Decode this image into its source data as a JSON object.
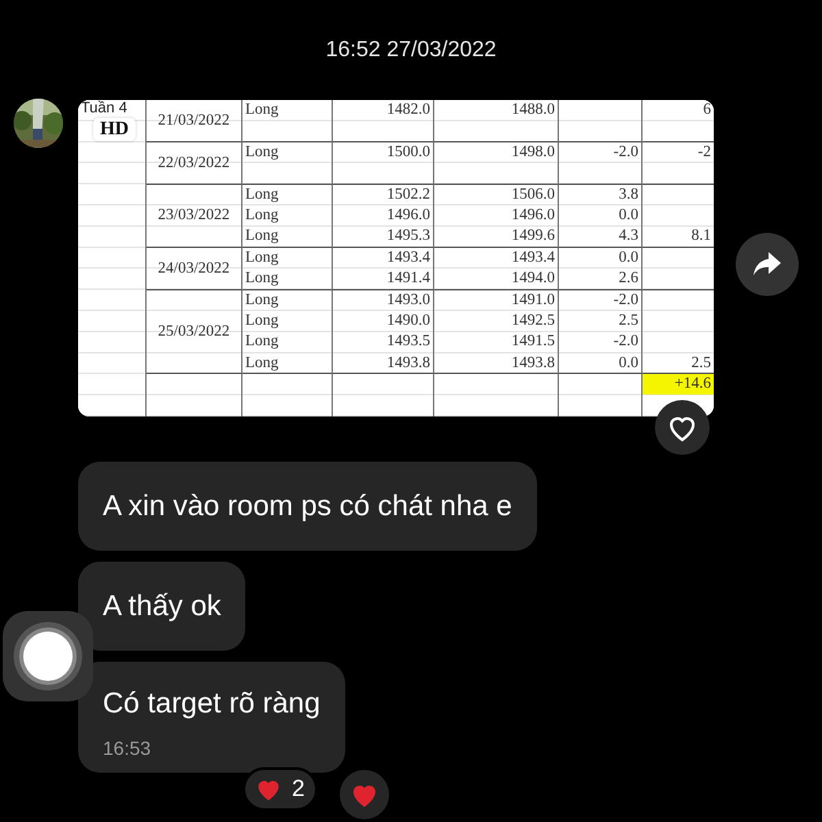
{
  "timestamp": "16:52 27/03/2022",
  "shared_image": {
    "week_label": "Tuần 4",
    "badge": "HD",
    "groups": [
      {
        "date": "21/03/2022",
        "trades": [
          {
            "side": "Long",
            "entry": "1482.0",
            "exit": "1488.0",
            "total": "6"
          }
        ]
      },
      {
        "date": "22/03/2022",
        "trades": [
          {
            "side": "Long",
            "entry": "1500.0",
            "exit": "1498.0",
            "pnl": "-2.0",
            "total": "-2"
          }
        ]
      },
      {
        "date": "23/03/2022",
        "trades": [
          {
            "side": "Long",
            "entry": "1502.2",
            "exit": "1506.0",
            "pnl": "3.8"
          },
          {
            "side": "Long",
            "entry": "1496.0",
            "exit": "1496.0",
            "pnl": "0.0"
          },
          {
            "side": "Long",
            "entry": "1495.3",
            "exit": "1499.6",
            "pnl": "4.3",
            "total": "8.1"
          }
        ]
      },
      {
        "date": "24/03/2022",
        "trades": [
          {
            "side": "Long",
            "entry": "1493.4",
            "exit": "1493.4",
            "pnl": "0.0"
          },
          {
            "side": "Long",
            "entry": "1491.4",
            "exit": "1494.0",
            "pnl": "2.6"
          }
        ]
      },
      {
        "date": "25/03/2022",
        "trades": [
          {
            "side": "Long",
            "entry": "1493.0",
            "exit": "1491.0",
            "pnl": "-2.0"
          },
          {
            "side": "Long",
            "entry": "1490.0",
            "exit": "1492.5",
            "pnl": "2.5"
          },
          {
            "side": "Long",
            "entry": "1493.5",
            "exit": "1491.5",
            "pnl": "-2.0"
          },
          {
            "side": "Long",
            "entry": "1493.8",
            "exit": "1493.8",
            "pnl": "0.0",
            "total": "2.5"
          }
        ]
      }
    ],
    "summary": {
      "total": "+14.6",
      "highlighted": true
    }
  },
  "messages": [
    {
      "text": "A xin vào room ps có chát nha e"
    },
    {
      "text": "A thấy ok"
    },
    {
      "text": "Có target rõ ràng",
      "time": "16:53",
      "reaction_count": "2",
      "reacted": true
    }
  ]
}
